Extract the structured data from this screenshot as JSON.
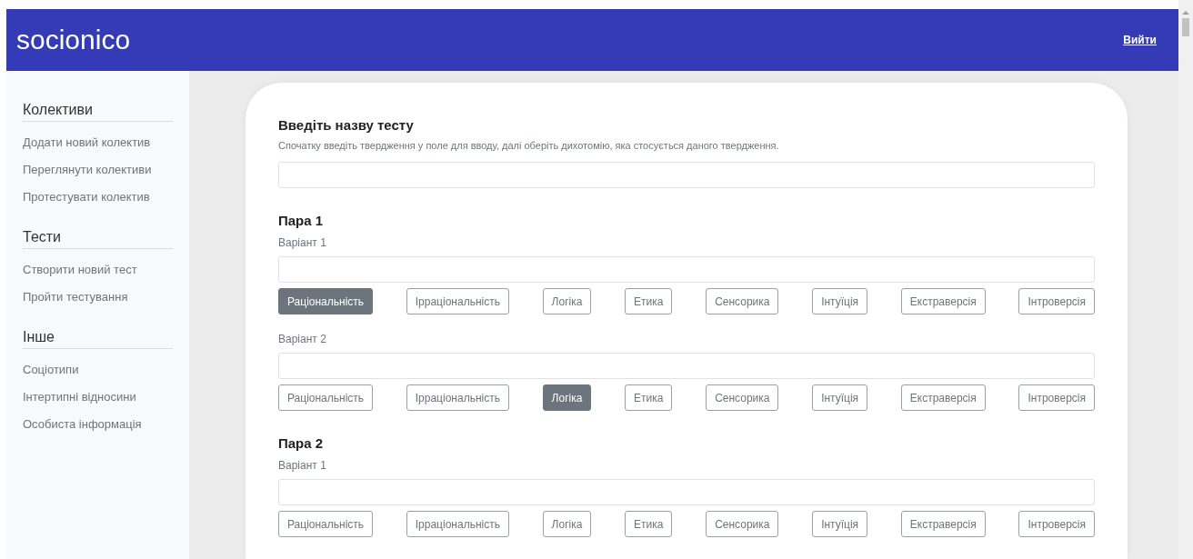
{
  "header": {
    "logo": "socionico",
    "logout": "Вийти"
  },
  "sidebar": {
    "sections": [
      {
        "heading": "Колективи",
        "items": [
          "Додати новий колектив",
          "Переглянути колективи",
          "Протестувати колектив"
        ]
      },
      {
        "heading": "Тести",
        "items": [
          "Створити новий тест",
          "Пройти тестування"
        ]
      },
      {
        "heading": "Інше",
        "items": [
          "Соціотипи",
          "Інтертипні відносини",
          "Особиста інформація"
        ]
      }
    ]
  },
  "form": {
    "title": "Введіть назву тесту",
    "hint": "Спочатку введіть твердження у поле для вводу, далі оберіть дихотомію, яка стосується даного твердження.",
    "pairs": [
      {
        "title": "Пара 1",
        "variants": [
          {
            "label": "Варіант 1",
            "options": [
              {
                "label": "Раціональність",
                "selected": true
              },
              {
                "label": "Ірраціональність",
                "selected": false
              },
              {
                "label": "Логіка",
                "selected": false
              },
              {
                "label": "Етика",
                "selected": false
              },
              {
                "label": "Сенсорика",
                "selected": false
              },
              {
                "label": "Інтуїція",
                "selected": false
              },
              {
                "label": "Екстраверсія",
                "selected": false
              },
              {
                "label": "Інтроверсія",
                "selected": false
              }
            ]
          },
          {
            "label": "Варіант 2",
            "options": [
              {
                "label": "Раціональність",
                "selected": false
              },
              {
                "label": "Ірраціональність",
                "selected": false
              },
              {
                "label": "Логіка",
                "selected": true
              },
              {
                "label": "Етика",
                "selected": false
              },
              {
                "label": "Сенсорика",
                "selected": false
              },
              {
                "label": "Інтуїція",
                "selected": false
              },
              {
                "label": "Екстраверсія",
                "selected": false
              },
              {
                "label": "Інтроверсія",
                "selected": false
              }
            ]
          }
        ]
      },
      {
        "title": "Пара 2",
        "variants": [
          {
            "label": "Варіант 1",
            "options": [
              {
                "label": "Раціональність",
                "selected": false
              },
              {
                "label": "Ірраціональність",
                "selected": false
              },
              {
                "label": "Логіка",
                "selected": false
              },
              {
                "label": "Етика",
                "selected": false
              },
              {
                "label": "Сенсорика",
                "selected": false
              },
              {
                "label": "Інтуїція",
                "selected": false
              },
              {
                "label": "Екстраверсія",
                "selected": false
              },
              {
                "label": "Інтроверсія",
                "selected": false
              }
            ]
          }
        ]
      }
    ]
  }
}
